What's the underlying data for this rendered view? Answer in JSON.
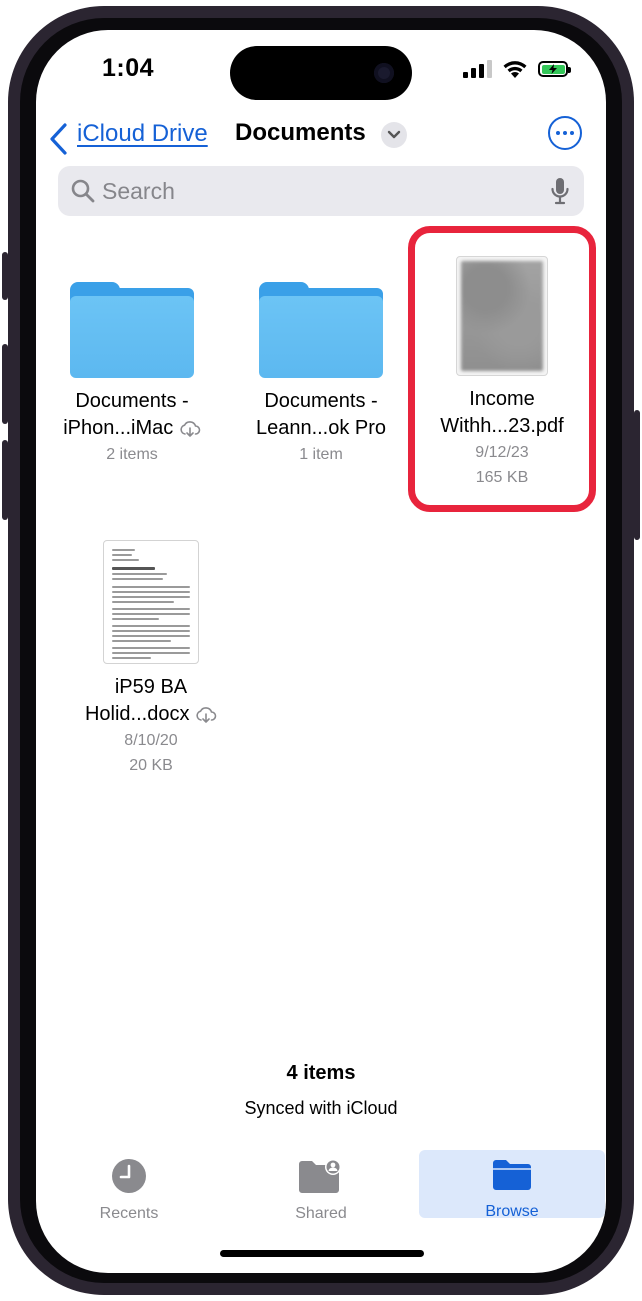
{
  "status_bar": {
    "time": "1:04"
  },
  "nav": {
    "back_label": "iCloud Drive",
    "title": "Documents"
  },
  "search": {
    "placeholder": "Search"
  },
  "items": [
    {
      "name_line1": "Documents -",
      "name_line2": "iPhon...iMac",
      "meta1": "2 items",
      "type": "folder",
      "cloud": true
    },
    {
      "name_line1": "Documents -",
      "name_line2": "Leann...ok Pro",
      "meta1": "1 item",
      "type": "folder",
      "cloud": false
    },
    {
      "name_line1": "Income",
      "name_line2": "Withh...23.pdf",
      "meta1": "9/12/23",
      "meta2": "165 KB",
      "type": "pdf",
      "cloud": false
    },
    {
      "name_line1": "iP59 BA",
      "name_line2": "Holid...docx",
      "meta1": "8/10/20",
      "meta2": "20 KB",
      "type": "docx",
      "cloud": true
    }
  ],
  "footer": {
    "count": "4 items",
    "sync": "Synced with iCloud"
  },
  "tabbar": {
    "tabs": [
      {
        "label": "Recents"
      },
      {
        "label": "Shared"
      },
      {
        "label": "Browse",
        "active": true
      }
    ]
  },
  "colors": {
    "accent": "#1561d6",
    "highlight": "#e8243c",
    "folder": "#5cb8f0",
    "battery": "#34c759"
  }
}
